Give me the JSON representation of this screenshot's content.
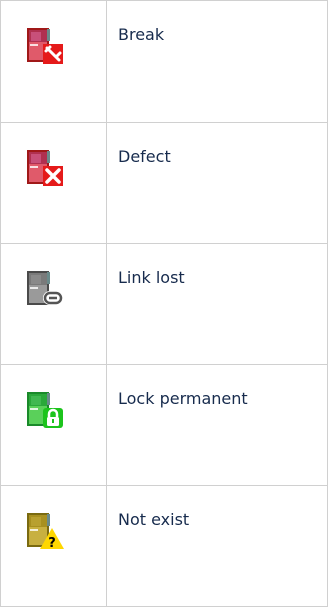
{
  "rows": [
    {
      "label": "Break",
      "icon": "door-break-icon",
      "color": "#c0392b"
    },
    {
      "label": "Defect",
      "icon": "door-defect-icon",
      "color": "#c0392b"
    },
    {
      "label": "Link lost",
      "icon": "door-link-lost-icon",
      "color": "#808080"
    },
    {
      "label": "Lock permanent",
      "icon": "door-lock-permanent-icon",
      "color": "#2ecc40"
    },
    {
      "label": "Not exist",
      "icon": "door-not-exist-icon",
      "color": "#b8a230"
    }
  ]
}
